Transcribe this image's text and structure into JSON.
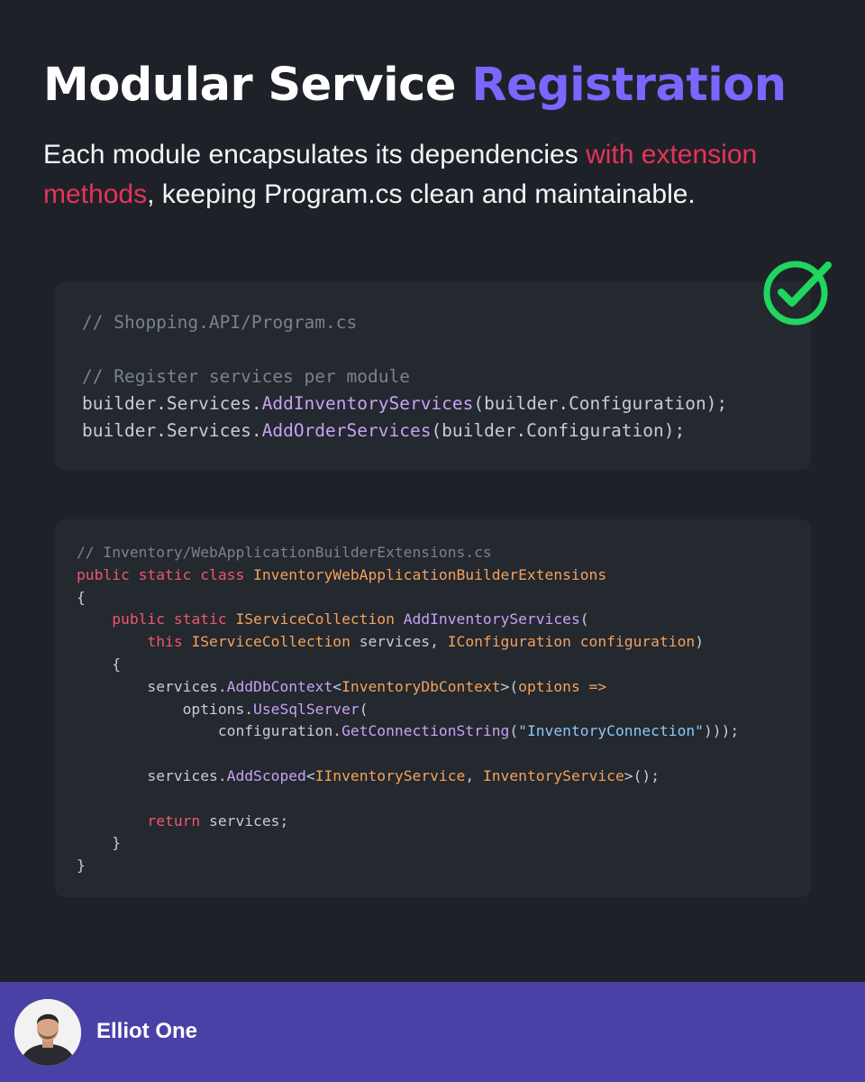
{
  "header": {
    "title_main": "Modular Service",
    "title_accent": "Registration",
    "subtitle_pre": "Each module encapsulates its dependencies",
    "subtitle_highlight": "with extension methods",
    "subtitle_post": ", keeping Program.cs clean and maintainable."
  },
  "colors": {
    "background": "#1e2228",
    "card": "#24282f",
    "accent": "#7b66ff",
    "highlight": "#e8325a",
    "check": "#1fd65f",
    "footer": "#4a41a6"
  },
  "status_icon": "check-circle-icon",
  "snippet1": {
    "lines": [
      [
        {
          "t": "// Shopping.API/Program.cs",
          "k": "comment"
        }
      ],
      [],
      [
        {
          "t": "// Register services per module",
          "k": "comment"
        }
      ],
      [
        {
          "t": "builder.Services.",
          "k": "plain"
        },
        {
          "t": "AddInventoryServices",
          "k": "method"
        },
        {
          "t": "(builder.Configuration);",
          "k": "plain"
        }
      ],
      [
        {
          "t": "builder.Services.",
          "k": "plain"
        },
        {
          "t": "AddOrderServices",
          "k": "method"
        },
        {
          "t": "(builder.Configuration);",
          "k": "plain"
        }
      ]
    ]
  },
  "snippet2": {
    "lines": [
      [
        {
          "t": "// Inventory/WebApplicationBuilderExtensions.cs",
          "k": "comment"
        }
      ],
      [
        {
          "t": "public static class ",
          "k": "kw"
        },
        {
          "t": "InventoryWebApplicationBuilderExtensions",
          "k": "type"
        }
      ],
      [
        {
          "t": "{",
          "k": "plain"
        }
      ],
      [
        {
          "t": "    ",
          "k": "plain"
        },
        {
          "t": "public static ",
          "k": "kw"
        },
        {
          "t": "IServiceCollection ",
          "k": "type"
        },
        {
          "t": "AddInventoryServices",
          "k": "method"
        },
        {
          "t": "(",
          "k": "plain"
        }
      ],
      [
        {
          "t": "        ",
          "k": "plain"
        },
        {
          "t": "this ",
          "k": "kw"
        },
        {
          "t": "IServiceCollection ",
          "k": "type"
        },
        {
          "t": "services",
          "k": "plain"
        },
        {
          "t": ", ",
          "k": "plain"
        },
        {
          "t": "IConfiguration configuration",
          "k": "type"
        },
        {
          "t": ")",
          "k": "plain"
        }
      ],
      [
        {
          "t": "    {",
          "k": "plain"
        }
      ],
      [
        {
          "t": "        services.",
          "k": "plain"
        },
        {
          "t": "AddDbContext",
          "k": "method"
        },
        {
          "t": "<",
          "k": "plain"
        },
        {
          "t": "InventoryDbContext",
          "k": "type"
        },
        {
          "t": ">(",
          "k": "plain"
        },
        {
          "t": "options =>",
          "k": "type"
        }
      ],
      [
        {
          "t": "            options.",
          "k": "plain"
        },
        {
          "t": "UseSqlServer",
          "k": "method"
        },
        {
          "t": "(",
          "k": "plain"
        }
      ],
      [
        {
          "t": "                configuration.",
          "k": "plain"
        },
        {
          "t": "GetConnectionString",
          "k": "method"
        },
        {
          "t": "(",
          "k": "plain"
        },
        {
          "t": "\"InventoryConnection\"",
          "k": "str"
        },
        {
          "t": ")));",
          "k": "plain"
        }
      ],
      [],
      [
        {
          "t": "        services.",
          "k": "plain"
        },
        {
          "t": "AddScoped",
          "k": "method"
        },
        {
          "t": "<",
          "k": "plain"
        },
        {
          "t": "IInventoryService",
          "k": "type"
        },
        {
          "t": ", ",
          "k": "plain"
        },
        {
          "t": "InventoryService",
          "k": "type"
        },
        {
          "t": ">();",
          "k": "plain"
        }
      ],
      [],
      [
        {
          "t": "        ",
          "k": "plain"
        },
        {
          "t": "return ",
          "k": "kw"
        },
        {
          "t": "services;",
          "k": "plain"
        }
      ],
      [
        {
          "t": "    }",
          "k": "plain"
        }
      ],
      [
        {
          "t": "}",
          "k": "plain"
        }
      ]
    ]
  },
  "footer": {
    "author_name": "Elliot One",
    "avatar_icon": "avatar-photo"
  }
}
